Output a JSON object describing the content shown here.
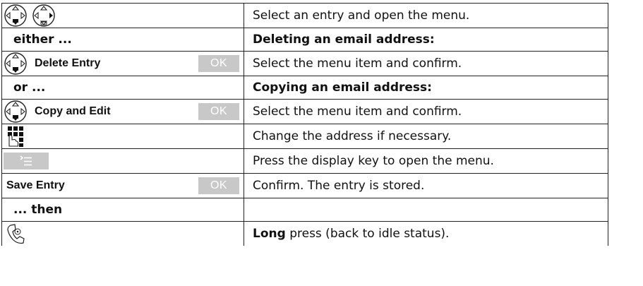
{
  "rows": [
    {
      "desc": "Select an entry and open the menu."
    },
    {
      "step": "either ...",
      "desc": "Deleting an email address:"
    },
    {
      "menu": "Delete Entry",
      "key": "OK",
      "desc": "Select the menu item and confirm."
    },
    {
      "step": "or ...",
      "desc": "Copying an email address:"
    },
    {
      "menu": "Copy and Edit",
      "key": "OK",
      "desc": "Select the menu item and confirm."
    },
    {
      "desc": "Change the address if necessary."
    },
    {
      "desc": "Press the display key to open the menu."
    },
    {
      "menu": "Save Entry",
      "key": "OK",
      "desc": "Confirm. The entry is stored."
    },
    {
      "step": "... then",
      "desc": ""
    },
    {
      "desc_bold": "Long",
      "desc_rest": " press (back to idle status)."
    }
  ],
  "icons": {
    "row0": [
      "control-key-down-icon",
      "control-key-right-icon"
    ],
    "row2": "control-key-down-icon",
    "row4": "control-key-down-icon",
    "row5": "keypad-icon",
    "row6": "menu-softkey-icon",
    "row9": "end-call-key-icon"
  }
}
